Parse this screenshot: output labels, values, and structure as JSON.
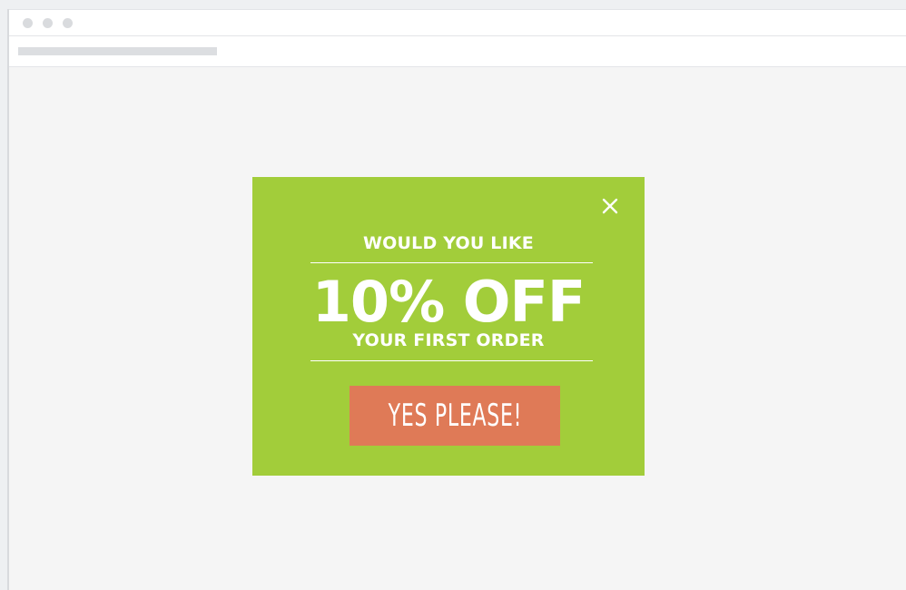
{
  "browser": {
    "window_controls": [
      "dot",
      "dot",
      "dot"
    ]
  },
  "popup": {
    "intro": "WOULD YOU LIKE",
    "offer": "10% OFF",
    "subtitle": "YOUR FIRST ORDER",
    "cta_label": "YES PLEASE!",
    "close_icon": "close-icon",
    "colors": {
      "background": "#a2cd3a",
      "button": "#df7a57",
      "text": "#ffffff"
    }
  }
}
